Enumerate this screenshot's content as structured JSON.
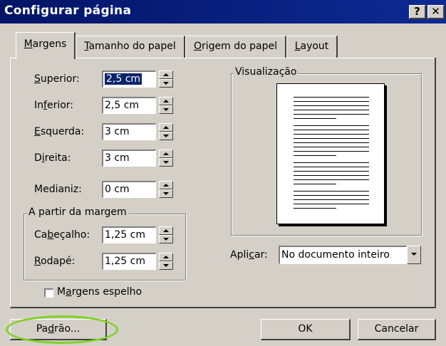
{
  "window": {
    "title": "Configurar página",
    "help_glyph": "?",
    "close_glyph": "✕"
  },
  "tabs": [
    {
      "pre": "",
      "acc": "M",
      "post": "argens"
    },
    {
      "pre": "",
      "acc": "T",
      "post": "amanho do papel"
    },
    {
      "pre": "",
      "acc": "O",
      "post": "rigem do papel"
    },
    {
      "pre": "",
      "acc": "L",
      "post": "ayout"
    }
  ],
  "margins": {
    "superior": {
      "pre": "",
      "acc": "S",
      "post": "uperior:",
      "value": "2,5 cm"
    },
    "inferior": {
      "pre": "In",
      "acc": "f",
      "post": "erior:",
      "value": "2,5 cm"
    },
    "esquerda": {
      "pre": "",
      "acc": "E",
      "post": "squerda:",
      "value": "3 cm"
    },
    "direita": {
      "pre": "D",
      "acc": "i",
      "post": "reita:",
      "value": "3 cm"
    },
    "medianiz": {
      "pre": "Medianiz",
      "acc": "",
      "post": ":",
      "acc2": "",
      "value": "0 cm"
    }
  },
  "from_edge": {
    "label": "A partir da margem",
    "cabecalho": {
      "pre": "Ca",
      "acc": "b",
      "post": "eçalho:",
      "value": "1,25 cm"
    },
    "rodape": {
      "pre": "",
      "acc": "R",
      "post": "odapé:",
      "value": "1,25 cm"
    }
  },
  "mirror": {
    "pre": "M",
    "acc": "a",
    "post": "rgens espelho",
    "checked": false
  },
  "preview": {
    "label": "Visualização"
  },
  "apply": {
    "pre": "Apli",
    "acc": "c",
    "post": "ar:",
    "value": "No documento inteiro"
  },
  "buttons": {
    "default": {
      "pre": "Pa",
      "acc": "d",
      "post": "rão..."
    },
    "ok": "OK",
    "cancel": "Cancelar"
  },
  "colors": {
    "titlebar": "#0a1f7f",
    "dialog": "#d4d0c8",
    "selection": "#0a246a",
    "highlight_ellipse": "#7ed321"
  }
}
